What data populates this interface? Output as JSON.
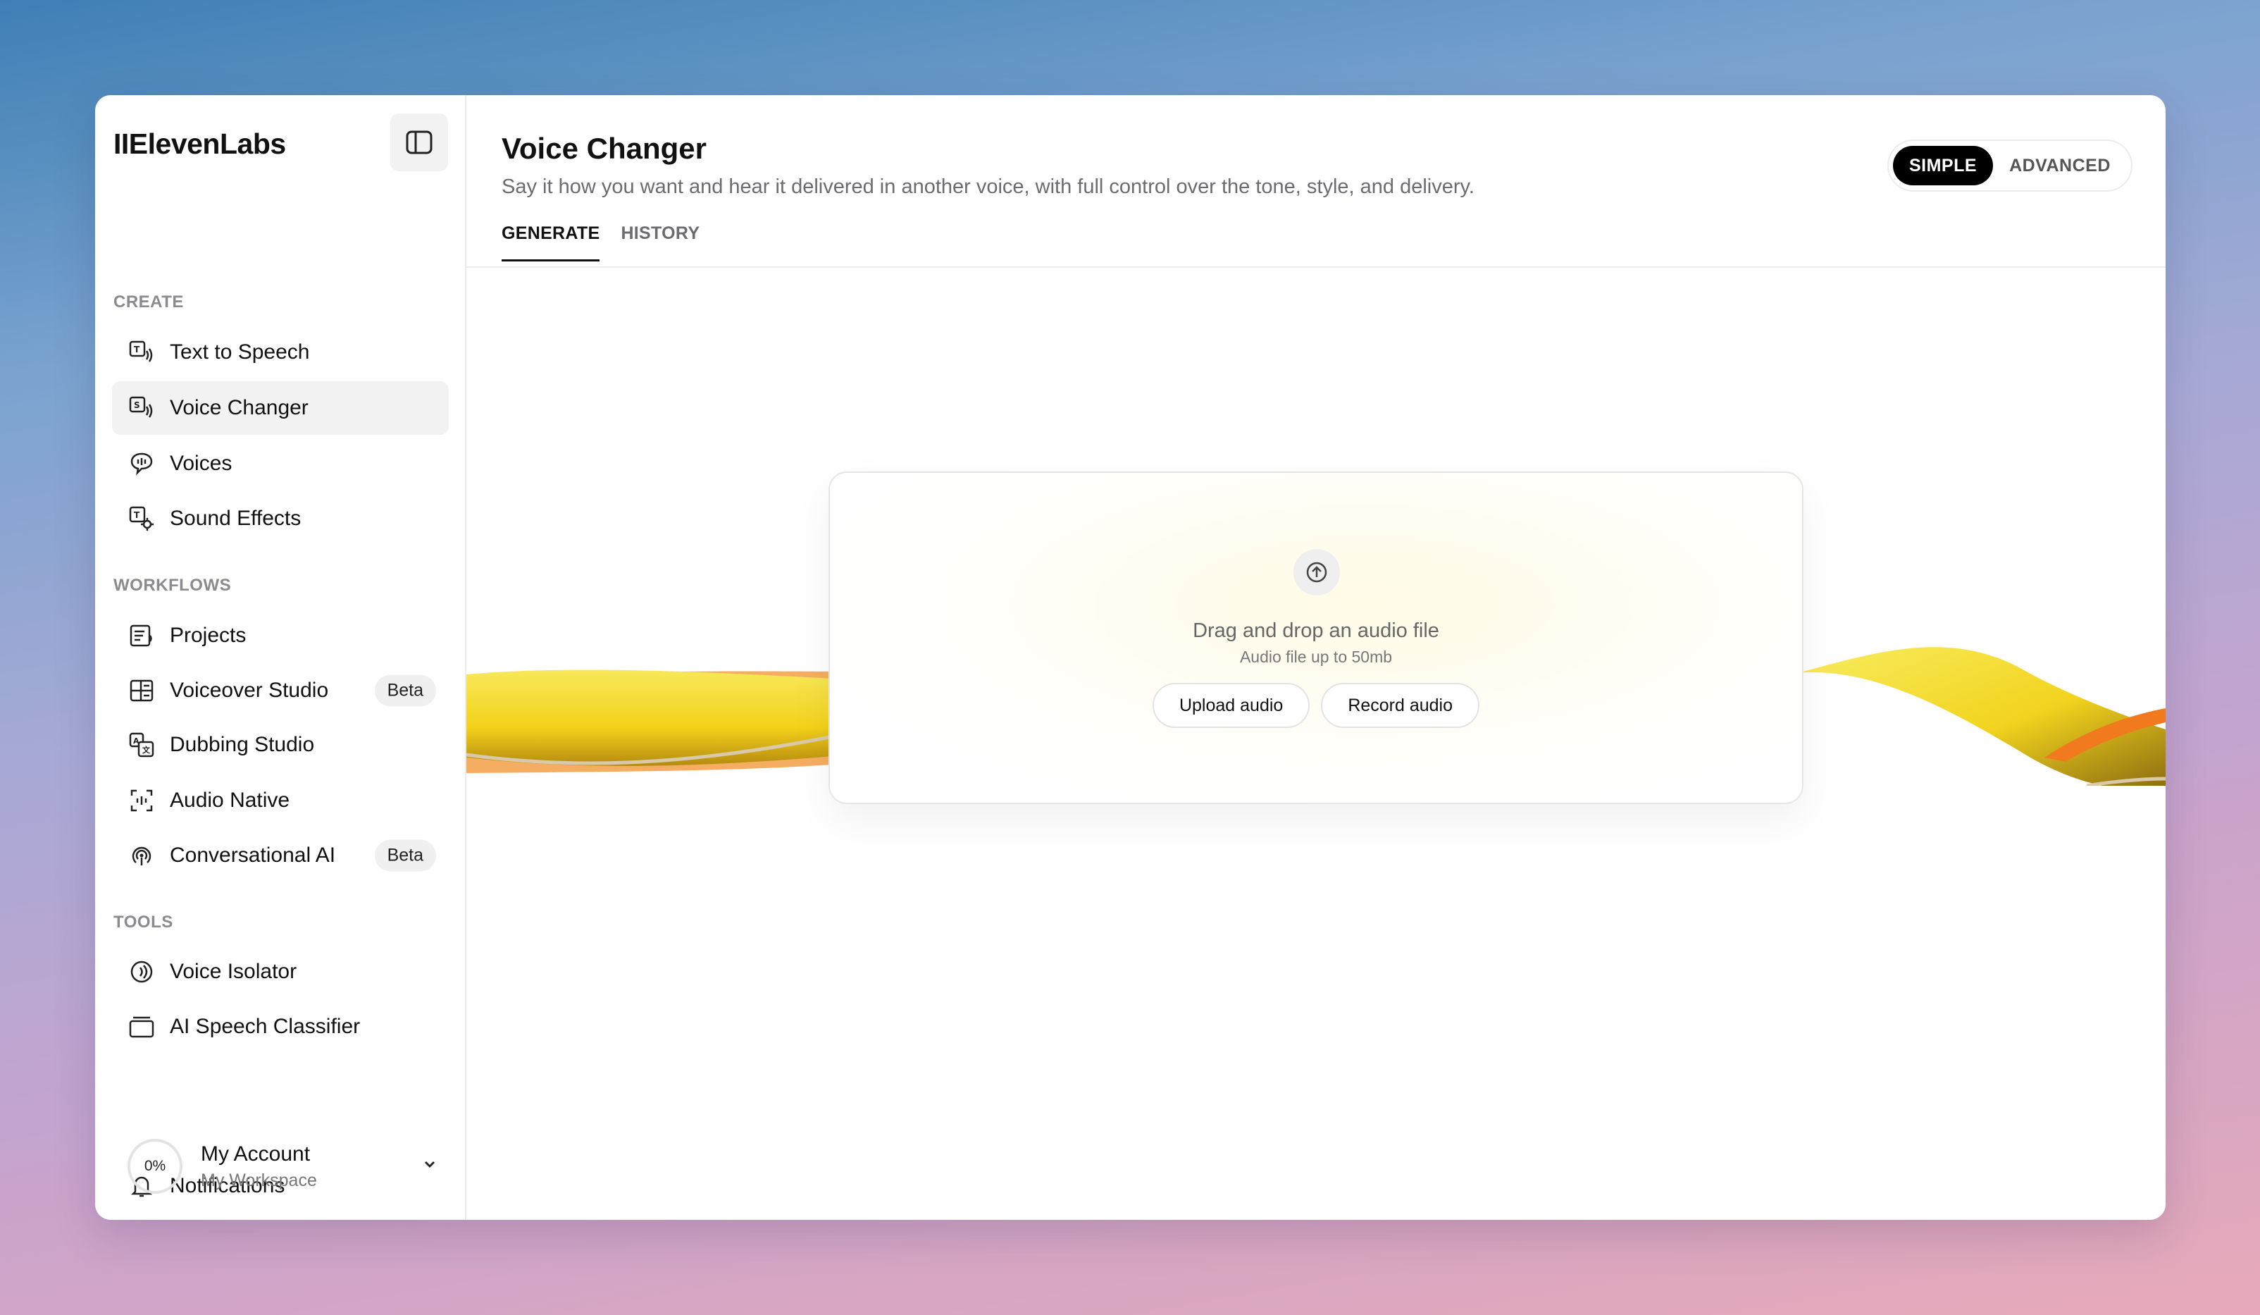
{
  "sidebar": {
    "logo": "IIElevenLabs",
    "sections": [
      {
        "label": "CREATE"
      },
      {
        "label": "WORKFLOWS"
      },
      {
        "label": "TOOLS"
      }
    ],
    "items": [
      {
        "label": "Text to Speech"
      },
      {
        "label": "Voice Changer"
      },
      {
        "label": "Voices"
      },
      {
        "label": "Sound Effects"
      },
      {
        "label": "Projects"
      },
      {
        "label": "Voiceover Studio",
        "badge": "Beta"
      },
      {
        "label": "Dubbing Studio"
      },
      {
        "label": "Audio Native"
      },
      {
        "label": "Conversational AI",
        "badge": "Beta"
      },
      {
        "label": "Voice Isolator"
      },
      {
        "label": "AI Speech Classifier"
      }
    ],
    "notifications": "Notifications",
    "account": {
      "progress": "0%",
      "name": "My Account",
      "workspace": "My Workspace"
    }
  },
  "main": {
    "title": "Voice Changer",
    "subtitle": "Say it how you want and hear it delivered in another voice, with full control over the tone, style, and delivery.",
    "mode": {
      "simple": "SIMPLE",
      "advanced": "ADVANCED",
      "selected": "SIMPLE"
    },
    "tabs": [
      {
        "label": "GENERATE"
      },
      {
        "label": "HISTORY"
      }
    ],
    "dropzone": {
      "title": "Drag and drop an audio file",
      "subtitle": "Audio file up to 50mb",
      "upload": "Upload audio",
      "record": "Record audio"
    }
  },
  "colors": {
    "accent_yellow": "#f5d21f",
    "accent_orange": "#f5862a",
    "active_bg": "#f2f2f3"
  }
}
